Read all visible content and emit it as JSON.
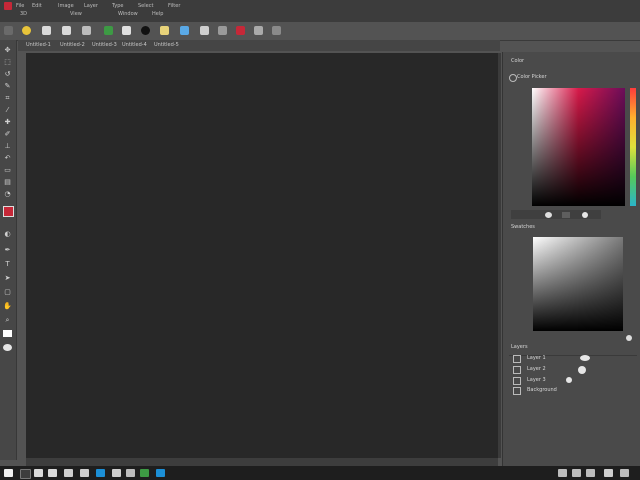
{
  "menubar": {
    "items": [
      "Ps",
      "File",
      "Edit",
      "Image",
      "Layer",
      "Type",
      "Select",
      "Filter",
      "3D",
      "View",
      "Window",
      "Help"
    ]
  },
  "tabs": [
    "Untitled-1",
    "Untitled-2",
    "Untitled-3",
    "Untitled-4",
    "Untitled-5"
  ],
  "panels": {
    "color": {
      "title": "Color",
      "subtitle": "Color Picker"
    },
    "swatch": {
      "title": "Swatches"
    },
    "layers": {
      "title": "Layers",
      "items": [
        {
          "name": "Layer 1"
        },
        {
          "name": "Layer 2"
        },
        {
          "name": "Layer 3"
        },
        {
          "name": "Background"
        }
      ]
    }
  },
  "colors": {
    "bg": "#535353",
    "menubar": "#3c3c3c",
    "canvas": "#282828",
    "panel": "#4a4a4a",
    "toolbar": "#474747",
    "accent_red": "#c62838",
    "accent_green": "#3d9a44",
    "accent_yellow": "#e8c43a",
    "taskbar_blue": "#1c8fd6"
  },
  "icons": {
    "toolbar": [
      "move-icon",
      "marquee-icon",
      "lasso-icon",
      "quick-select-icon",
      "crop-icon",
      "eyedropper-icon",
      "healing-icon",
      "brush-icon",
      "clone-stamp-icon",
      "history-brush-icon",
      "eraser-icon",
      "gradient-icon",
      "blur-icon",
      "dodge-icon",
      "pen-icon",
      "type-icon",
      "path-select-icon",
      "shape-icon",
      "hand-icon",
      "zoom-icon"
    ],
    "options": [
      "new-icon",
      "open-icon",
      "save-icon",
      "export-icon",
      "folder-icon",
      "layer-icon",
      "mask-icon",
      "adjust-icon",
      "color-icon",
      "swap-icon",
      "trash-icon",
      "undo-icon"
    ]
  }
}
